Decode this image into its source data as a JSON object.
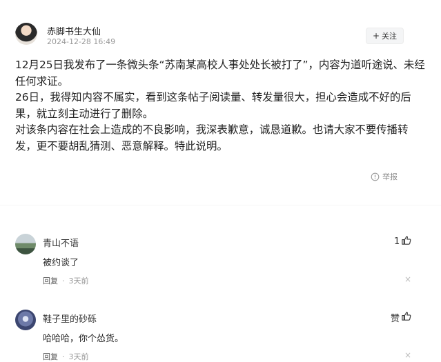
{
  "post": {
    "author": "赤脚书生大仙",
    "time": "2024-12-28 16:49",
    "follow_label": "关注",
    "paragraphs": [
      "12月25日我发布了一条微头条“苏南某高校人事处处长被打了”，内容为道听途说、未经任何求证。",
      "26日，我得知内容不属实，看到这条帖子阅读量、转发量很大，担心会造成不好的后果，就立刻主动进行了删除。",
      "对该条内容在社会上造成的不良影响，我深表歉意，诚恳道歉。也请大家不要传播转发，更不要胡乱猜测、恶意解释。特此说明。"
    ],
    "report_label": "举报"
  },
  "comments": [
    {
      "name": "青山不语",
      "text": "被约谈了",
      "reply_label": "回复",
      "dot": "·",
      "time": "3天前",
      "like": "1",
      "close": "×"
    },
    {
      "name": "鞋子里的砂砾",
      "text": "哈哈哈，你个怂货。",
      "reply_label": "回复",
      "dot": "·",
      "time": "3天前",
      "like": "赞",
      "close": "×"
    }
  ]
}
